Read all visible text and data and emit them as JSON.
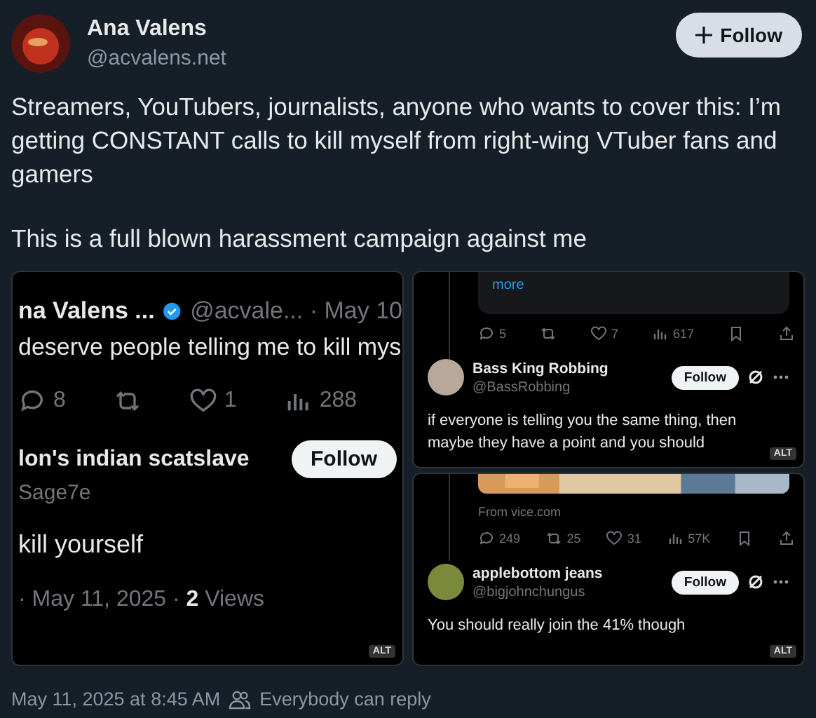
{
  "author": {
    "name": "Ana Valens",
    "handle": "@acvalens.net"
  },
  "follow_button": {
    "label": "Follow"
  },
  "text": [
    "Streamers, YouTubers, journalists, anyone who wants to cover this: I’m getting CONSTANT calls to kill myself from right-wing VTuber fans and gamers",
    "This is a full blown harassment campaign against me"
  ],
  "attachments": [
    {
      "kind": "quote_reply",
      "quoted": {
        "name": "na Valens ...",
        "handle": "@acvale... · May 10",
        "text": "deserve people telling me to kill mys",
        "stats": [
          {
            "kind": "reply",
            "value": "8"
          },
          {
            "kind": "repost"
          },
          {
            "kind": "like",
            "value": "1"
          },
          {
            "kind": "views",
            "value": "288"
          }
        ]
      },
      "reply": {
        "name": "lon's indian scatslave",
        "handle": "Sage7e",
        "follow": "Follow",
        "text": "kill yourself",
        "meta": "· May 11, 2025 · **2** Views"
      },
      "alt": "ALT"
    },
    {
      "kind": "reply_thread",
      "link": "more",
      "stats": [
        {
          "kind": "reply",
          "value": "5"
        },
        {
          "kind": "repost"
        },
        {
          "kind": "like",
          "value": "7"
        },
        {
          "kind": "views",
          "value": "617"
        },
        {
          "kind": "bookmark"
        },
        {
          "kind": "share"
        }
      ],
      "reply": {
        "name": "Bass King Robbing",
        "handle": "@BassRobbing",
        "follow": "Follow",
        "text": "if everyone is telling you the same thing, then maybe they have a point and you should",
        "color": "#b8a89a"
      },
      "alt": "ALT"
    },
    {
      "kind": "reply_thread",
      "source": "From vice.com",
      "stats": [
        {
          "kind": "reply",
          "value": "249"
        },
        {
          "kind": "repost",
          "value": "25"
        },
        {
          "kind": "like",
          "value": "31"
        },
        {
          "kind": "views",
          "value": "57K"
        },
        {
          "kind": "bookmark"
        },
        {
          "kind": "share"
        }
      ],
      "reply": {
        "name": "applebottom jeans",
        "handle": "@bigjohnchungus",
        "follow": "Follow",
        "text": "You should really join the 41% though",
        "color": "#7a8a3a"
      },
      "alt": "ALT"
    }
  ],
  "footer": {
    "timestamp": "May 11, 2025 at 8:45 AM",
    "reply_setting": "Everybody can reply"
  }
}
